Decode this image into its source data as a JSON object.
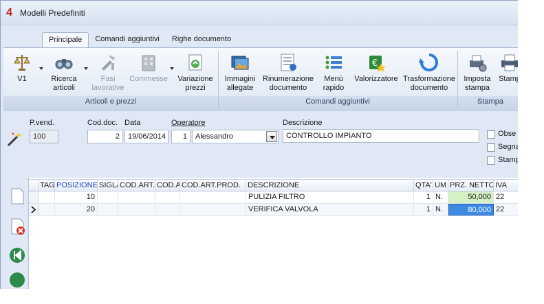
{
  "window": {
    "title": "Modelli Predefiniti",
    "logo": "4"
  },
  "tabs": [
    {
      "label": "Principale",
      "active": true
    },
    {
      "label": "Comandi aggiuntivi",
      "active": false
    },
    {
      "label": "Righe documento",
      "active": false
    }
  ],
  "ribbon": {
    "groups": [
      "Articoli e prezzi",
      "Comandi aggiuntivi",
      "Stampa"
    ],
    "buttons": {
      "v1": "V1",
      "ricerca_1": "Ricerca",
      "ricerca_2": "articoli",
      "fasi_1": "Fasi",
      "fasi_2": "lavorative",
      "commesse": "Commesse",
      "variazione_1": "Variazione",
      "variazione_2": "prezzi",
      "immagini_1": "Immagini",
      "immagini_2": "allegate",
      "rinumerazione_1": "Rinumerazione",
      "rinumerazione_2": "documento",
      "menu_1": "Menù",
      "menu_2": "rapido",
      "valorizzatore": "Valorizzatore",
      "trasformazione_1": "Trasformazione",
      "trasformazione_2": "documento",
      "imposta_1": "Imposta",
      "imposta_2": "stampa",
      "stampa": "Stamp"
    }
  },
  "form": {
    "pvend_label": "P.vend.",
    "pvend_value": "100",
    "coddoc_label": "Cod.doc.",
    "coddoc_value": "2",
    "data_label": "Data",
    "data_value": "19/06/2014",
    "operatore_label": "Operatore",
    "operatore_id": "1",
    "operatore_name": "Alessandro",
    "descrizione_label": "Descrizione",
    "descrizione_value": "CONTROLLO IMPIANTO",
    "checkboxes": [
      "Obse",
      "Segna",
      "Stampat"
    ]
  },
  "grid": {
    "columns": [
      "TAG",
      "POSIZIONE",
      "SIGLA",
      "COD.ART.",
      "COD.A",
      "COD.ART.PROD.",
      "DESCRIZIONE",
      "QTA'",
      "UM",
      "PRZ. NETTO",
      "IVA"
    ],
    "rows": [
      {
        "posizione": "10",
        "descrizione": "PULIZIA FILTRO",
        "qta": "1",
        "um": "N.",
        "prezzo": "50,000",
        "iva": "22"
      },
      {
        "posizione": "20",
        "descrizione": "VERIFICA VALVOLA",
        "qta": "1",
        "um": "N.",
        "prezzo": "80,000",
        "iva": "22"
      }
    ]
  },
  "colors": {
    "accent": "#3e8ae3",
    "logo": "#c8211f",
    "highlight_green": "#d4f0c4"
  }
}
